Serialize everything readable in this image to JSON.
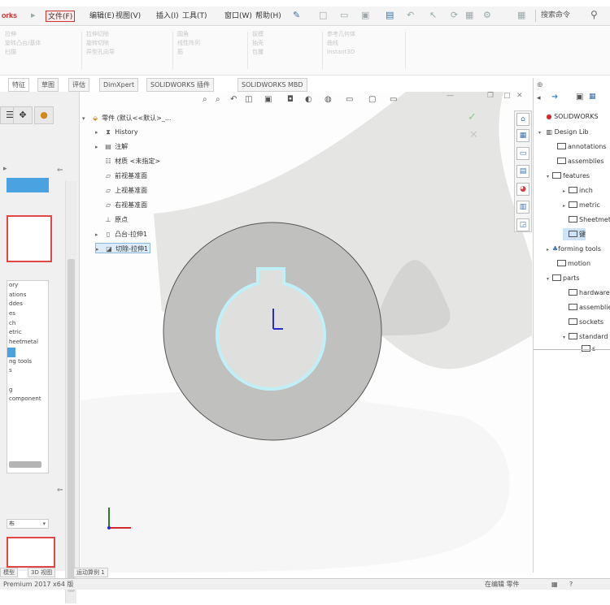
{
  "menubar": {
    "logo": "orks",
    "items": [
      "文件(F)",
      "编辑(E)",
      "视图(V)",
      "插入(I)",
      "工具(T)",
      "窗口(W)",
      "帮助(H)"
    ],
    "search_placeholder": "搜索命令"
  },
  "ribbon": {
    "groups": [
      [
        "拉伸",
        "旋转凸台/基体",
        "扫描"
      ],
      [
        "拉伸切除",
        "旋转切除",
        "异型孔向导"
      ],
      [
        "圆角",
        "线性阵列",
        "筋"
      ],
      [
        "拔模",
        "抽壳",
        "包覆"
      ],
      [
        "参考几何体",
        "曲线",
        "Instant3D"
      ]
    ]
  },
  "tabs": [
    "特征",
    "草图",
    "评估",
    "DimXpert",
    "SOLIDWORKS 插件",
    "SOLIDWORKS MBD"
  ],
  "left_panel": {
    "list_items": [
      "ory",
      "ations",
      "ddes",
      "es",
      "ch",
      "etric",
      "heetmetal",
      "",
      "ng tools",
      "s",
      "",
      "g",
      "component",
      "",
      "",
      "",
      "",
      "",
      "",
      ""
    ]
  },
  "feature_tree": [
    {
      "label": "零件 (默认<<默认>_...",
      "icon": "part-icon",
      "expand": "▾"
    },
    {
      "label": "History",
      "icon": "history-icon",
      "expand": "▸"
    },
    {
      "label": "注解",
      "icon": "annotation-icon",
      "expand": "▸"
    },
    {
      "label": "材质 <未指定>",
      "icon": "material-icon",
      "expand": ""
    },
    {
      "label": "前视基准面",
      "icon": "plane-icon",
      "expand": ""
    },
    {
      "label": "上视基准面",
      "icon": "plane-icon",
      "expand": ""
    },
    {
      "label": "右视基准面",
      "icon": "plane-icon",
      "expand": ""
    },
    {
      "label": "原点",
      "icon": "origin-icon",
      "expand": ""
    },
    {
      "label": "凸台-拉伸1",
      "icon": "boss-extrude-icon",
      "expand": "▸"
    },
    {
      "label": "切除-拉伸1",
      "icon": "cut-extrude-icon",
      "expand": "▸"
    }
  ],
  "task_pane": {
    "rows": [
      {
        "label": "SOLIDWORKS",
        "level": 0,
        "expand": ""
      },
      {
        "label": "Design Lib",
        "level": 0,
        "expand": "▾"
      },
      {
        "label": "annotations",
        "level": 1,
        "expand": ""
      },
      {
        "label": "assemblies",
        "level": 1,
        "expand": ""
      },
      {
        "label": "features",
        "level": 1,
        "expand": "▾"
      },
      {
        "label": "inch",
        "level": 2,
        "expand": "▸"
      },
      {
        "label": "metric",
        "level": 2,
        "expand": "▸"
      },
      {
        "label": "Sheetmetal",
        "level": 2,
        "expand": ""
      },
      {
        "label": "键",
        "level": 2,
        "expand": ""
      },
      {
        "label": "forming tools",
        "level": 0,
        "expand": "▸"
      },
      {
        "label": "motion",
        "level": 1,
        "expand": ""
      },
      {
        "label": "parts",
        "level": 0,
        "expand": "▾"
      },
      {
        "label": "hardware",
        "level": 1,
        "expand": ""
      },
      {
        "label": "assemblies",
        "level": 1,
        "expand": ""
      },
      {
        "label": "sockets",
        "level": 1,
        "expand": ""
      },
      {
        "label": "standard",
        "level": 1,
        "expand": "▾"
      },
      {
        "label": "s",
        "level": 2,
        "expand": ""
      }
    ]
  },
  "bottom_tabs": [
    "模型",
    "3D 视图",
    "运动算例 1"
  ],
  "status": {
    "left": "Premium 2017 x64 版",
    "right": "在编辑 零件"
  }
}
